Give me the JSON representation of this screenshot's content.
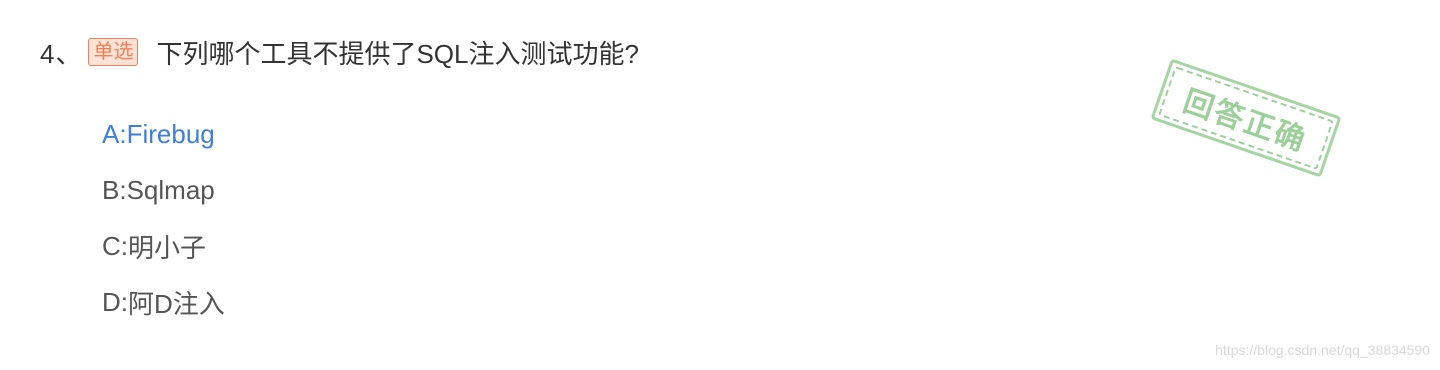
{
  "question": {
    "number": "4、",
    "type_badge": "单选",
    "text": "下列哪个工具不提供了SQL注入测试功能?"
  },
  "options": [
    {
      "letter": "A:",
      "text": "Firebug",
      "selected": true
    },
    {
      "letter": "B:",
      "text": "Sqlmap",
      "selected": false
    },
    {
      "letter": "C:",
      "text": "明小子",
      "selected": false
    },
    {
      "letter": "D:",
      "text": "阿D注入",
      "selected": false
    }
  ],
  "result_stamp": "回答正确",
  "watermark": "https://blog.csdn.net/qq_38834590",
  "colors": {
    "correct_option": "#3d7fd9",
    "badge_border": "#f08055",
    "badge_bg": "#fbe3d8",
    "stamp": "#7cbf79"
  }
}
